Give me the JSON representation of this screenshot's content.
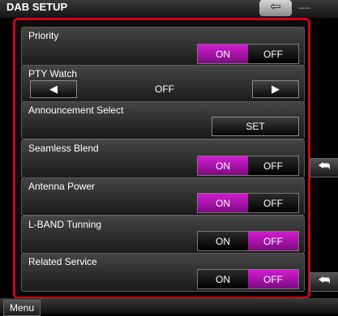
{
  "header": {
    "title": "DAB SETUP",
    "back_icon": "return-arrow-icon",
    "indicator": "----"
  },
  "settings": {
    "priority": {
      "label": "Priority",
      "on": "ON",
      "off": "OFF",
      "selected": "ON"
    },
    "pty_watch": {
      "label": "PTY Watch",
      "value": "OFF",
      "prev_icon": "left-triangle-icon",
      "next_icon": "right-triangle-icon"
    },
    "announcement_select": {
      "label": "Announcement Select",
      "button": "SET"
    },
    "seamless_blend": {
      "label": "Seamless Blend",
      "on": "ON",
      "off": "OFF",
      "selected": "ON"
    },
    "antenna_power": {
      "label": "Antenna Power",
      "on": "ON",
      "off": "OFF",
      "selected": "ON"
    },
    "lband_tuning": {
      "label": "L-BAND Tunning",
      "on": "ON",
      "off": "OFF",
      "selected": "OFF"
    },
    "related_service": {
      "label": "Related Service",
      "on": "ON",
      "off": "OFF",
      "selected": "OFF"
    }
  },
  "footer": {
    "menu_label": "Menu"
  },
  "colors": {
    "accent_selected": "#b515b8",
    "highlight_border": "#d0021b"
  }
}
